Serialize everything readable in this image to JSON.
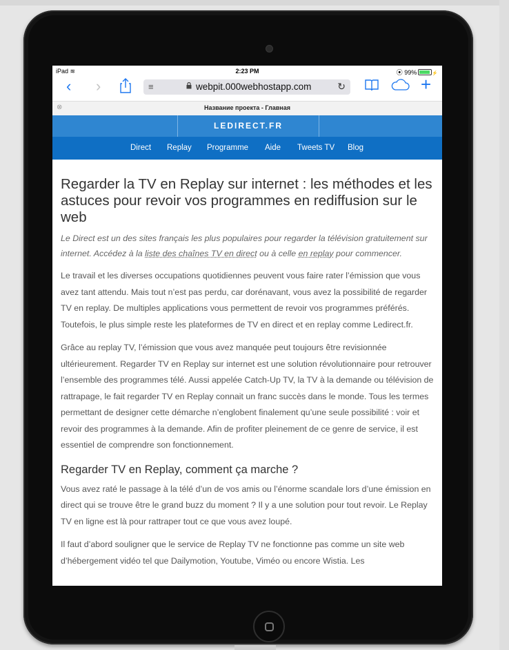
{
  "status": {
    "device": "iPad",
    "time": "2:23 PM",
    "battery": "99%"
  },
  "browser": {
    "reader_icon": "≡",
    "lock_icon": "🔒",
    "url": "webpit.000webhostapp.com",
    "tab_title": "Название проекта - Главная"
  },
  "site": {
    "logo": "LEDIRECT.FR",
    "nav": [
      "Direct",
      "Replay",
      "Programme",
      "Aide",
      "Tweets TV",
      "Blog"
    ]
  },
  "article": {
    "title": "Regarder la TV en Replay sur internet : les méthodes et les astuces pour revoir vos programmes en rediffusion sur le web",
    "intro_a": "Le Direct est un des sites français les plus populaires pour regarder la télévision gratuitement sur internet. Accédez à la ",
    "intro_link1": "liste des chaînes TV en direct",
    "intro_b": " ou à celle ",
    "intro_link2": "en replay",
    "intro_c": " pour commencer.",
    "p1": "Le travail et les diverses occupations quotidiennes peuvent vous faire rater l’émission que vous avez tant attendu. Mais tout n’est pas perdu, car dorénavant, vous avez la possibilité de regarder TV en replay. De multiples applications vous permettent de revoir vos programmes préférés. Toutefois, le plus simple reste les plateformes de TV en direct et en replay comme Ledirect.fr.",
    "p2": "Grâce au replay TV, l’émission que vous avez manquée peut toujours être revisionnée ultérieurement. Regarder TV en Replay sur internet est une solution révolutionnaire pour retrouver l’ensemble des programmes télé. Aussi appelée Catch-Up TV, la TV à la demande ou télévision de rattrapage, le fait regarder TV en Replay connait un franc succès dans le monde. Tous les termes permettant de designer cette démarche n’englobent finalement qu’une seule possibilité : voir et revoir des programmes à la demande. Afin de profiter pleinement de ce genre de service, il est essentiel de comprendre son fonctionnement.",
    "h2": "Regarder TV en Replay, comment ça marche ?",
    "p3": "Vous avez raté le passage à la télé d’un de vos amis ou l’énorme scandale lors d’une émission en direct qui se trouve être le grand buzz du moment ? Il y a une solution pour tout revoir. Le Replay TV en ligne est là pour rattraper tout ce que vous avez loupé.",
    "p4": "Il faut d’abord souligner que le service de Replay TV ne fonctionne pas comme un site web d’hébergement vidéo tel que Dailymotion, Youtube, Viméo ou encore Wistia. Les"
  },
  "colors": {
    "accent": "#1e78f0",
    "banner": "#2f86d1",
    "nav": "#0f6fc4"
  }
}
